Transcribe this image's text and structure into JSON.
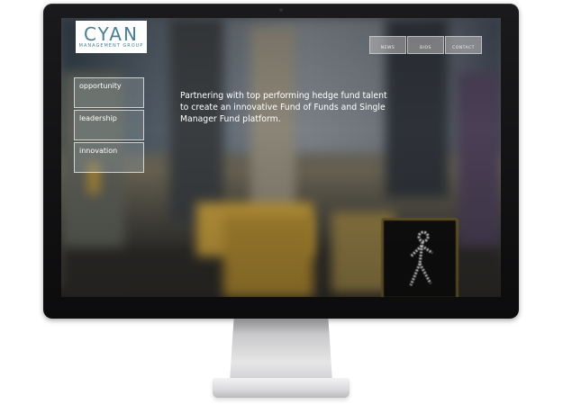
{
  "site": {
    "logo": {
      "word": "CYAN",
      "subtitle": "MANAGEMENT GROUP",
      "color": "#4a7f91"
    },
    "top_nav": [
      {
        "label": "NEWS"
      },
      {
        "label": "BIOS"
      },
      {
        "label": "CONTACT"
      }
    ],
    "side_menu": [
      {
        "label": "opportunity"
      },
      {
        "label": "leadership"
      },
      {
        "label": "innovation"
      }
    ],
    "tagline": "Partnering with top performing hedge fund talent to create an innovative Fund of Funds and Single Manager Fund platform."
  },
  "device": {
    "bezel_color": "#111112",
    "stand_color": "#d8d8da"
  },
  "icons": [
    "webcam-icon",
    "walk-signal-icon"
  ]
}
